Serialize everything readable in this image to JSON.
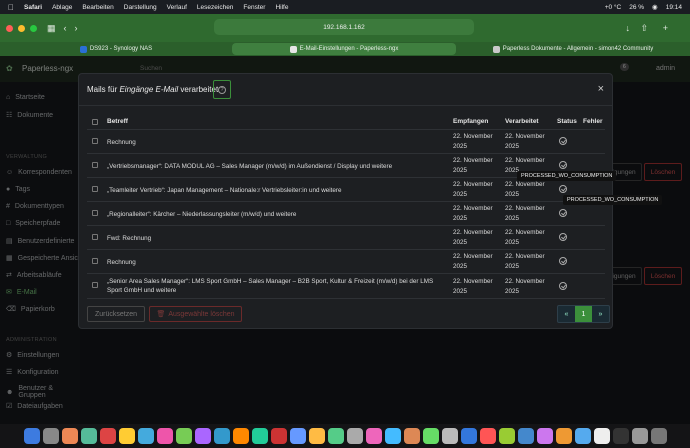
{
  "menubar": {
    "apple": "",
    "items": [
      "Safari",
      "Ablage",
      "Bearbeiten",
      "Darstellung",
      "Verlauf",
      "Lesezeichen",
      "Fenster",
      "Hilfe"
    ],
    "weather": "+0 °C",
    "battery": "26 %",
    "clock": "19:14"
  },
  "browser": {
    "url": "192.168.1.162",
    "tabs": [
      {
        "label": "DS923 - Synology NAS",
        "color": "#2a6fd6"
      },
      {
        "label": "E-Mail-Einstellungen - Paperless-ngx",
        "color": "#e6e6e6"
      },
      {
        "label": "Paperless Dokumente - Allgemein - simon42 Community",
        "color": "#c9c9c9"
      }
    ]
  },
  "app": {
    "brand": "Paperless-ngx",
    "search_placeholder": "Suchen",
    "user": "admin",
    "notifications": "6",
    "sidebar": {
      "items_top": [
        "Startseite",
        "Dokumente"
      ],
      "section_admin_label": "VERWALTUNG",
      "items_manage": [
        "Korrespondenten",
        "Tags",
        "Dokumenttypen",
        "Speicherpfade",
        "Benutzerdefinierte",
        "Gespeicherte Ansic",
        "Arbeitsabläufe",
        "E-Mail",
        "Papierkorb"
      ],
      "section_system_label": "ADMINISTRATION",
      "items_system": [
        "Einstellungen",
        "Konfiguration",
        "Benutzer & Gruppen",
        "Dateiaufgaben"
      ]
    },
    "bg_buttons": {
      "edit1": "igungen",
      "delete1": "Löschen",
      "edit2": "igungen",
      "delete2": "Löschen"
    }
  },
  "modal": {
    "title_prefix": "Mails für ",
    "title_em": "Eingänge E-Mail",
    "title_suffix": " verarbeitet",
    "help_icon": "?",
    "close_icon": "×",
    "columns": {
      "subject": "Betreff",
      "received": "Empfangen",
      "processed": "Verarbeitet",
      "status": "Status",
      "error": "Fehler"
    },
    "rows": [
      {
        "subject": "Rechnung",
        "received": "22. November 2025",
        "processed": "22. November 2025"
      },
      {
        "subject": "„Vertriebsmanager“: DATA MODUL AG – Sales Manager (m/w/d) im Außendienst / Display und weitere",
        "received": "22. November 2025",
        "processed": "22. November 2025"
      },
      {
        "subject": "„Teamleiter Vertrieb“: Japan Management – Nationale:r Vertriebsleiter:in und weitere",
        "received": "22. November 2025",
        "processed": "22. November 2025"
      },
      {
        "subject": "„Regionalleiter“: Kärcher – Niederlassungsleiter (m/w/d) und weitere",
        "received": "22. November 2025",
        "processed": "22. November 2025"
      },
      {
        "subject": "Fwd: Rechnung",
        "received": "22. November 2025",
        "processed": "22. November 2025"
      },
      {
        "subject": "Rechnung",
        "received": "22. November 2025",
        "processed": "22. November 2025"
      },
      {
        "subject": "„Senior Area Sales Manager“: LMS Sport GmbH – Sales Manager – B2B Sport, Kultur & Freizeit (m/w/d) bei der LMS Sport GmbH und weitere",
        "received": "22. November 2025",
        "processed": "22. November 2025"
      }
    ],
    "tooltips": [
      "PROCESSED_WO_CONSUMPTION",
      "PROCESSED_WO_CONSUMPTION"
    ],
    "reset_label": "Zurücksetzen",
    "delete_label": "Ausgewählte löschen",
    "pager": {
      "prev": "«",
      "page": "1",
      "next": "»"
    }
  }
}
